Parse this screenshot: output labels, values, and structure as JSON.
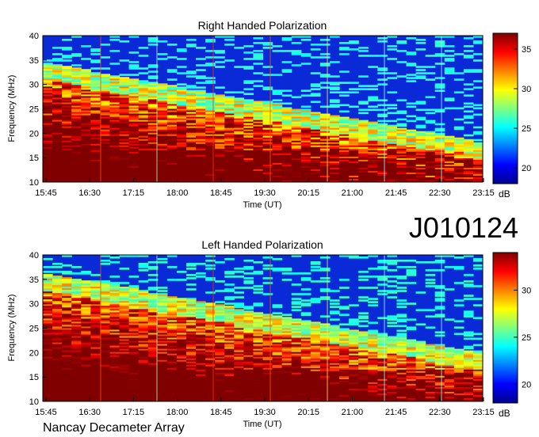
{
  "identifier": "J010124",
  "footer": "Nancay Decameter Array",
  "chart_data": [
    {
      "type": "heatmap",
      "title": "Right Handed Polarization",
      "xlabel": "Time (UT)",
      "ylabel": "Frequency (MHz)",
      "x_ticks": [
        "15:45",
        "16:30",
        "17:15",
        "18:00",
        "18:45",
        "19:30",
        "20:15",
        "21:00",
        "21:45",
        "22:30",
        "23:15"
      ],
      "y_ticks": [
        10,
        15,
        20,
        25,
        30,
        35,
        40
      ],
      "ylim": [
        10,
        40
      ],
      "colorbar": {
        "label": "dB",
        "ticks": [
          20,
          25,
          30,
          35
        ],
        "range": [
          18,
          37
        ]
      }
    },
    {
      "type": "heatmap",
      "title": "Left Handed Polarization",
      "xlabel": "Time (UT)",
      "ylabel": "Frequency (MHz)",
      "x_ticks": [
        "15:45",
        "16:30",
        "17:15",
        "18:00",
        "18:45",
        "19:30",
        "20:15",
        "21:00",
        "21:45",
        "22:30",
        "23:15"
      ],
      "y_ticks": [
        10,
        15,
        20,
        25,
        30,
        35,
        40
      ],
      "ylim": [
        10,
        40
      ],
      "colorbar": {
        "label": "dB",
        "ticks": [
          20,
          25,
          30
        ],
        "range": [
          18,
          34
        ]
      }
    }
  ]
}
